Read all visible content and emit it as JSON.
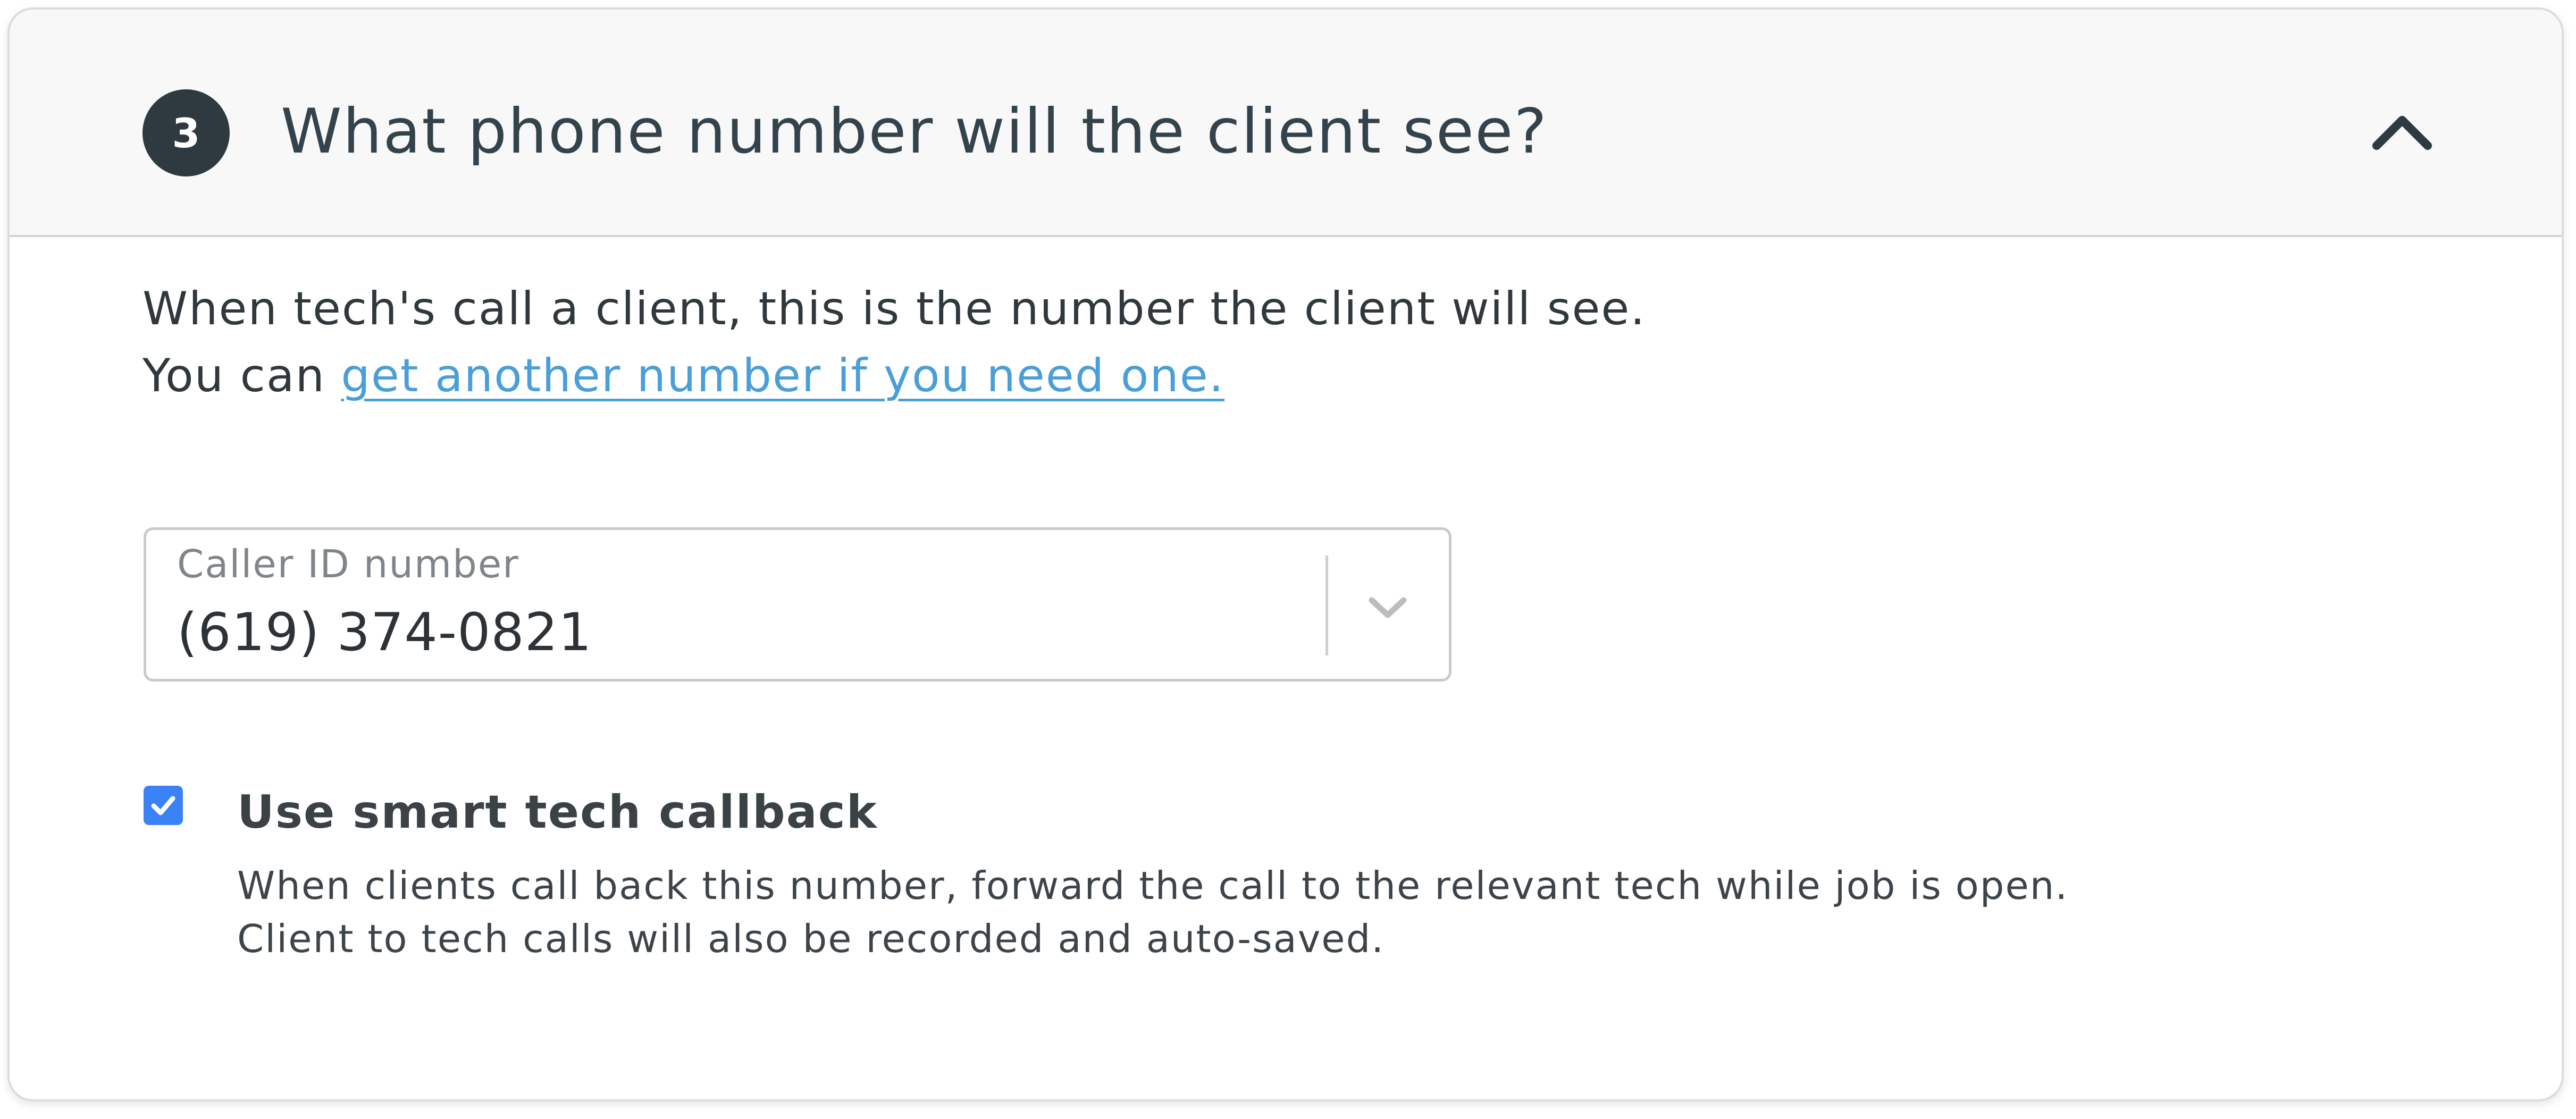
{
  "section": {
    "step_number": "3",
    "title": "What phone number will the client see?",
    "collapse_icon": "chevron-up-icon"
  },
  "intro": {
    "line1": "When tech's call a client, this is the number the client will see.",
    "line2_prefix": "You can ",
    "link_text": "get another number if you need one."
  },
  "caller_id": {
    "label": "Caller ID number",
    "value": "(619) 374-0821",
    "dropdown_icon": "chevron-down-icon"
  },
  "smart_callback": {
    "checked": true,
    "label": "Use smart tech callback",
    "desc_line1": "When clients call back this number, forward the call to the relevant tech while job is open.",
    "desc_line2": "Client to tech calls will also be recorded and auto-saved."
  },
  "colors": {
    "badge": "#2e3a40",
    "link": "#4a9fd8",
    "checkbox": "#3b82f6",
    "header_bg": "#f8f8f8"
  }
}
